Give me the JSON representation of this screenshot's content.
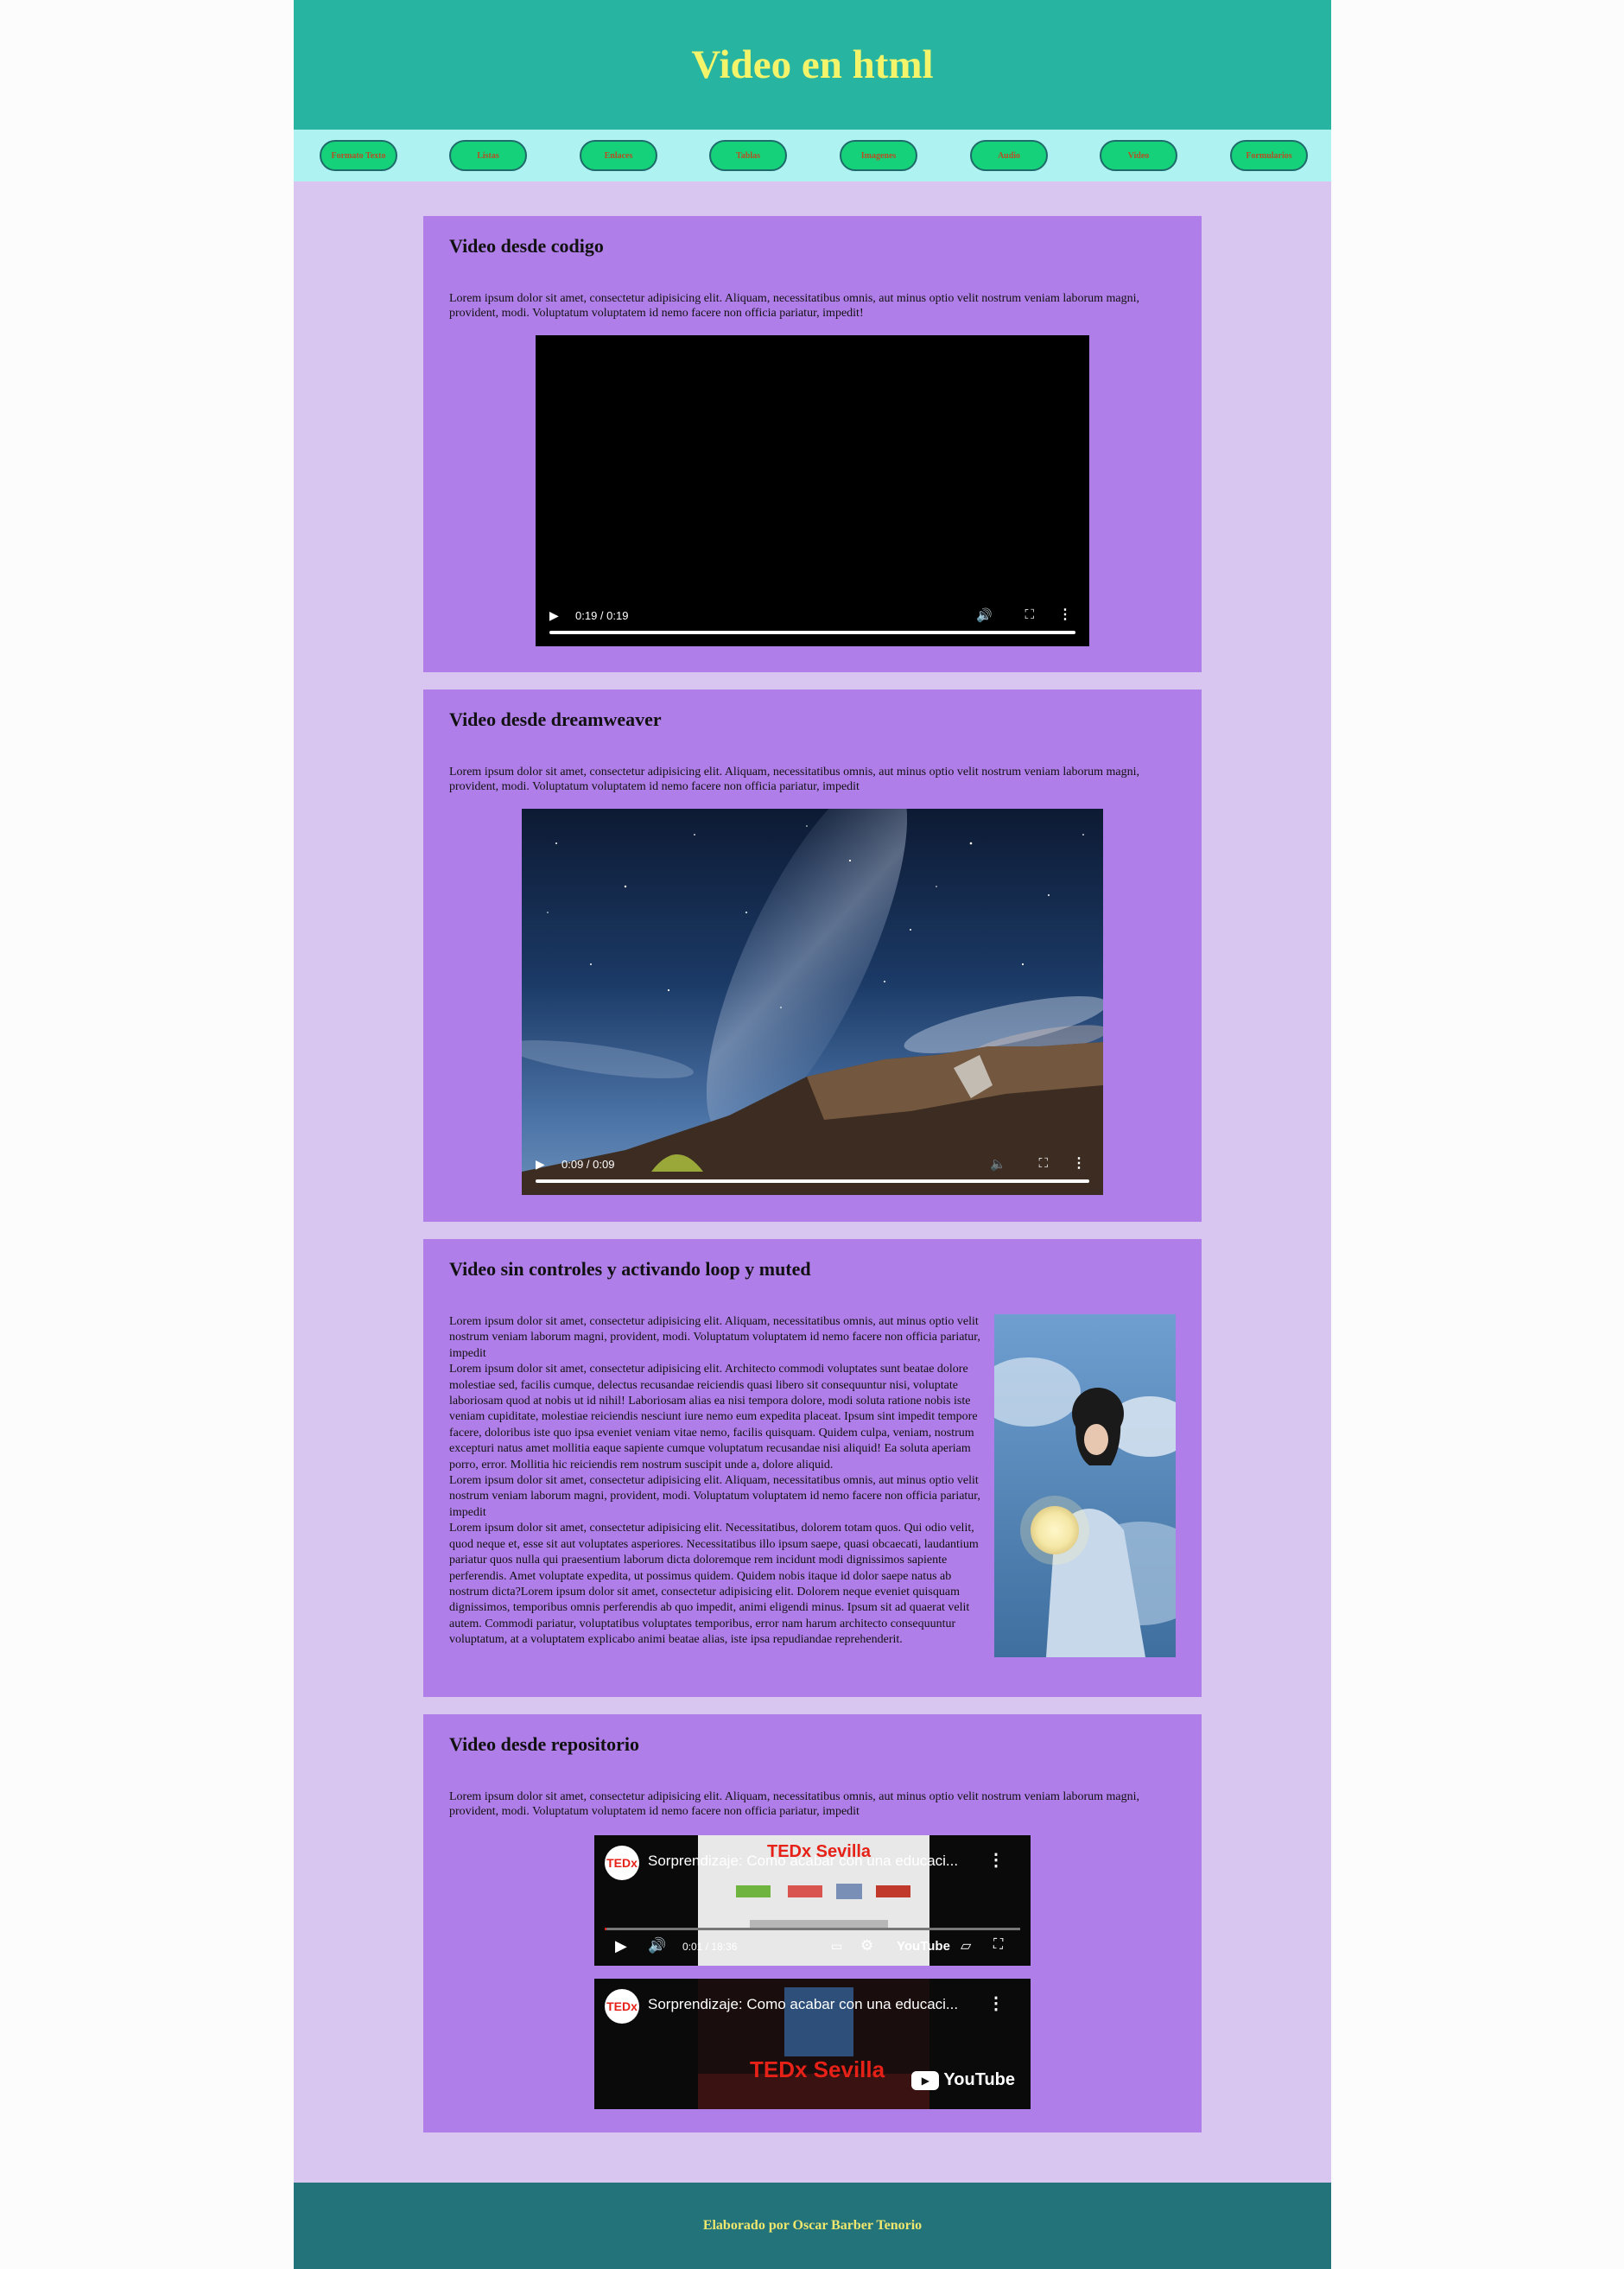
{
  "header": {
    "title": "Video en html"
  },
  "nav": {
    "items": [
      {
        "label": "Formato Texto"
      },
      {
        "label": "Listas"
      },
      {
        "label": "Enlaces"
      },
      {
        "label": "Tablas"
      },
      {
        "label": "Imagenes"
      },
      {
        "label": "Audio"
      },
      {
        "label": "Video"
      },
      {
        "label": "Formularios"
      }
    ]
  },
  "sections": [
    {
      "title": "Video desde codigo",
      "text": "Lorem ipsum dolor sit amet, consectetur adipisicing elit. Aliquam, necessitatibus omnis, aut minus optio velit nostrum veniam laborum magni, provident, modi. Voluptatum voluptatem id nemo facere non officia pariatur, impedit!",
      "video": {
        "time": "0:19 / 0:19",
        "progress": 1.0
      }
    },
    {
      "title": "Video desde dreamweaver",
      "text": "Lorem ipsum dolor sit amet, consectetur adipisicing elit. Aliquam, necessitatibus omnis, aut minus optio velit nostrum veniam laborum magni, provident, modi. Voluptatum voluptatem id nemo facere non officia pariatur, impedit",
      "video": {
        "time": "0:09 / 0:09",
        "progress": 1.0
      }
    },
    {
      "title": "Video sin controles y activando loop y muted",
      "paragraphs": [
        "Lorem ipsum dolor sit amet, consectetur adipisicing elit. Aliquam, necessitatibus omnis, aut minus optio velit nostrum veniam laborum magni, provident, modi. Voluptatum voluptatem id nemo facere non officia pariatur, impedit",
        "Lorem ipsum dolor sit amet, consectetur adipisicing elit. Architecto commodi voluptates sunt beatae dolore molestiae sed, facilis cumque, delectus recusandae reiciendis quasi libero sit consequuntur nisi, voluptate laboriosam quod at nobis ut id nihil! Laboriosam alias ea nisi tempora dolore, modi soluta ratione nobis iste veniam cupiditate, molestiae reiciendis nesciunt iure nemo eum expedita placeat. Ipsum sint impedit tempore facere, doloribus iste quo ipsa eveniet veniam vitae nemo, facilis quisquam. Quidem culpa, veniam, nostrum excepturi natus amet mollitia eaque sapiente cumque voluptatum recusandae nisi aliquid! Ea soluta aperiam porro, error. Mollitia hic reiciendis rem nostrum suscipit unde a, dolore aliquid.",
        "Lorem ipsum dolor sit amet, consectetur adipisicing elit. Aliquam, necessitatibus omnis, aut minus optio velit nostrum veniam laborum magni, provident, modi. Voluptatum voluptatem id nemo facere non officia pariatur, impedit",
        "Lorem ipsum dolor sit amet, consectetur adipisicing elit. Necessitatibus, dolorem totam quos. Qui odio velit, quod neque et, esse sit aut voluptates asperiores. Necessitatibus illo ipsum saepe, quasi obcaecati, laudantium pariatur quos nulla qui praesentium laborum dicta doloremque rem incidunt modi dignissimos sapiente perferendis. Amet voluptate expedita, ut possimus quidem. Quidem nobis itaque id dolor saepe natus ab nostrum dicta?Lorem ipsum dolor sit amet, consectetur adipisicing elit. Dolorem neque eveniet quisquam dignissimos, temporibus omnis perferendis ab quo impedit, animi eligendi minus. Ipsum sit ad quaerat velit autem. Commodi pariatur, voluptatibus voluptates temporibus, error nam harum architecto consequuntur voluptatum, at a voluptatem explicabo animi beatae alias, iste ipsa repudiandae reprehenderit."
      ]
    },
    {
      "title": "Video desde repositorio",
      "text": "Lorem ipsum dolor sit amet, consectetur adipisicing elit. Aliquam, necessitatibus omnis, aut minus optio velit nostrum veniam laborum magni, provident, modi. Voluptatum voluptatem id nemo facere non officia pariatur, impedit",
      "embeds": [
        {
          "channel": "TEDx",
          "title": "Sorprendizaje: Como acabar con una educaci...",
          "time": "0:01 / 18:36",
          "brand": "YouTube",
          "event": "TEDx Sevilla",
          "progress": 0.001
        },
        {
          "channel": "TEDx",
          "title": "Sorprendizaje: Como acabar con una educaci...",
          "brand": "YouTube",
          "event": "TEDx Sevilla"
        }
      ]
    }
  ],
  "footer": {
    "text": "Elaborado por Oscar Barber Tenorio"
  },
  "colors": {
    "header_bg": "#27b5a2",
    "title": "#f3f46a",
    "nav_bg": "#aef2f1",
    "nav_button": "#15d17a",
    "nav_text": "#b65025",
    "page_bg": "#d9c6f0",
    "section_bg": "#b07ee8",
    "footer_bg": "#23737a"
  }
}
